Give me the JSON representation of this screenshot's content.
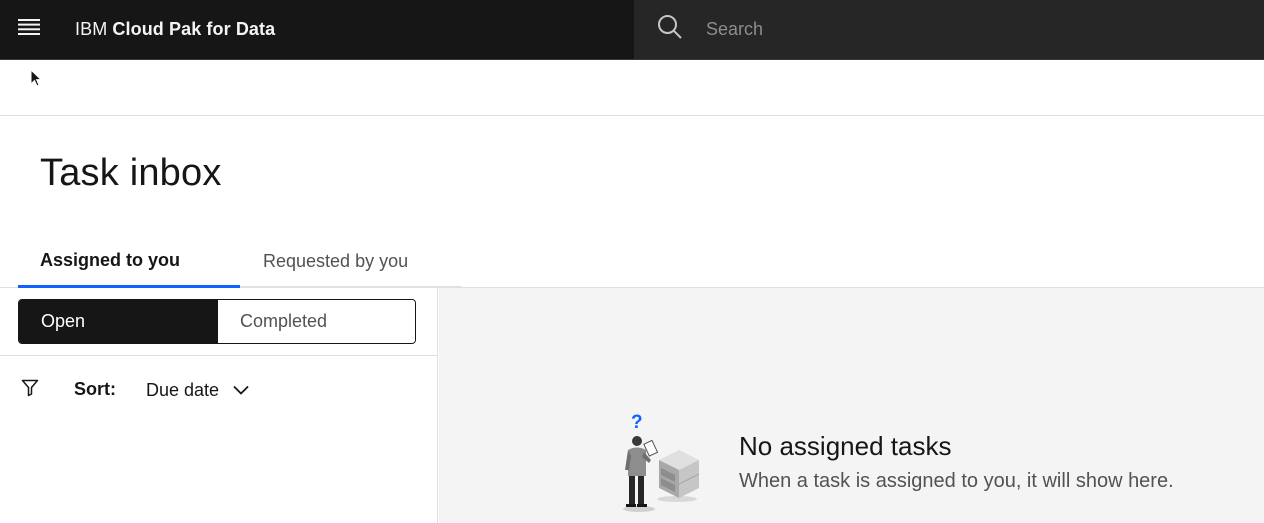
{
  "header": {
    "brand_prefix": "IBM",
    "brand_name": "Cloud Pak for Data",
    "menu_icon": "hamburger-menu-icon",
    "search_icon": "search-icon",
    "search_placeholder": "Search"
  },
  "page": {
    "title": "Task inbox"
  },
  "tabs": [
    {
      "label": "Assigned to you",
      "active": true
    },
    {
      "label": "Requested by you",
      "active": false
    }
  ],
  "status_switcher": {
    "options": [
      {
        "label": "Open",
        "selected": true
      },
      {
        "label": "Completed",
        "selected": false
      }
    ]
  },
  "sort": {
    "filter_icon": "filter-icon",
    "label": "Sort:",
    "value": "Due date",
    "chevron_icon": "chevron-down-icon"
  },
  "empty_state": {
    "illustration_icon": "person-with-cabinet-illustration",
    "question_mark": "?",
    "title": "No assigned tasks",
    "description": "When a task is assigned to you, it will show here."
  },
  "colors": {
    "header_bg": "#161616",
    "search_bg": "#262626",
    "accent": "#0f62fe",
    "panel_bg": "#f4f4f4"
  }
}
